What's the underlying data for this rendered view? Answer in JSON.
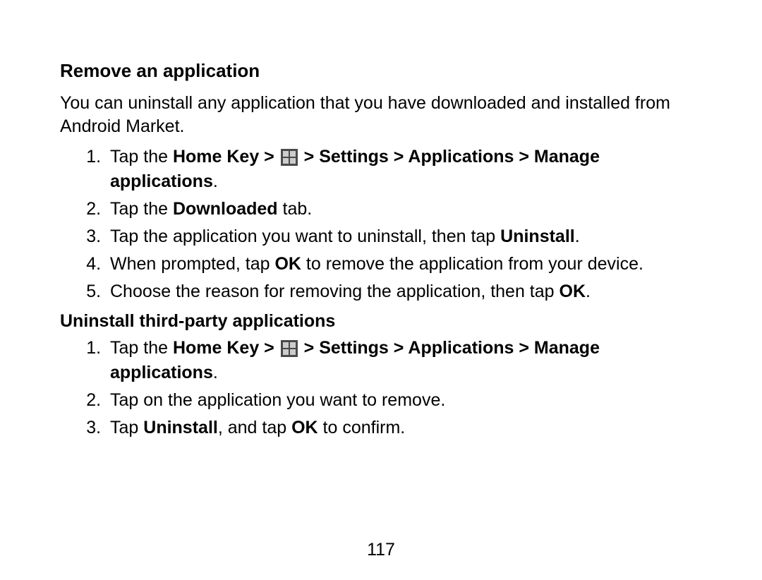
{
  "heading": "Remove an application",
  "intro": "You can uninstall any application that you have downloaded and installed from Android Market.",
  "list1": {
    "item1": {
      "t1": "Tap the ",
      "b1": "Home Key > ",
      "b2": " > Settings > Applications > Manage applications",
      "t2": "."
    },
    "item2": {
      "t1": "Tap the ",
      "b1": "Downloaded",
      "t2": " tab."
    },
    "item3": {
      "t1": "Tap the application you want to uninstall, then tap ",
      "b1": "Uninstall",
      "t2": "."
    },
    "item4": {
      "t1": "When prompted, tap ",
      "b1": "OK",
      "t2": " to remove the application from your device."
    },
    "item5": {
      "t1": "Choose the reason for removing the application, then tap ",
      "b1": "OK",
      "t2": "."
    }
  },
  "subheading": "Uninstall third-party applications",
  "list2": {
    "item1": {
      "t1": "Tap the ",
      "b1": "Home Key > ",
      "b2": " > Settings > Applications > Manage applications",
      "t2": "."
    },
    "item2": {
      "t1": "Tap on the application you want to remove."
    },
    "item3": {
      "t1": "Tap ",
      "b1": "Uninstall",
      "t2": ", and tap ",
      "b2": "OK",
      "t3": " to confirm."
    }
  },
  "pageNumber": "117"
}
